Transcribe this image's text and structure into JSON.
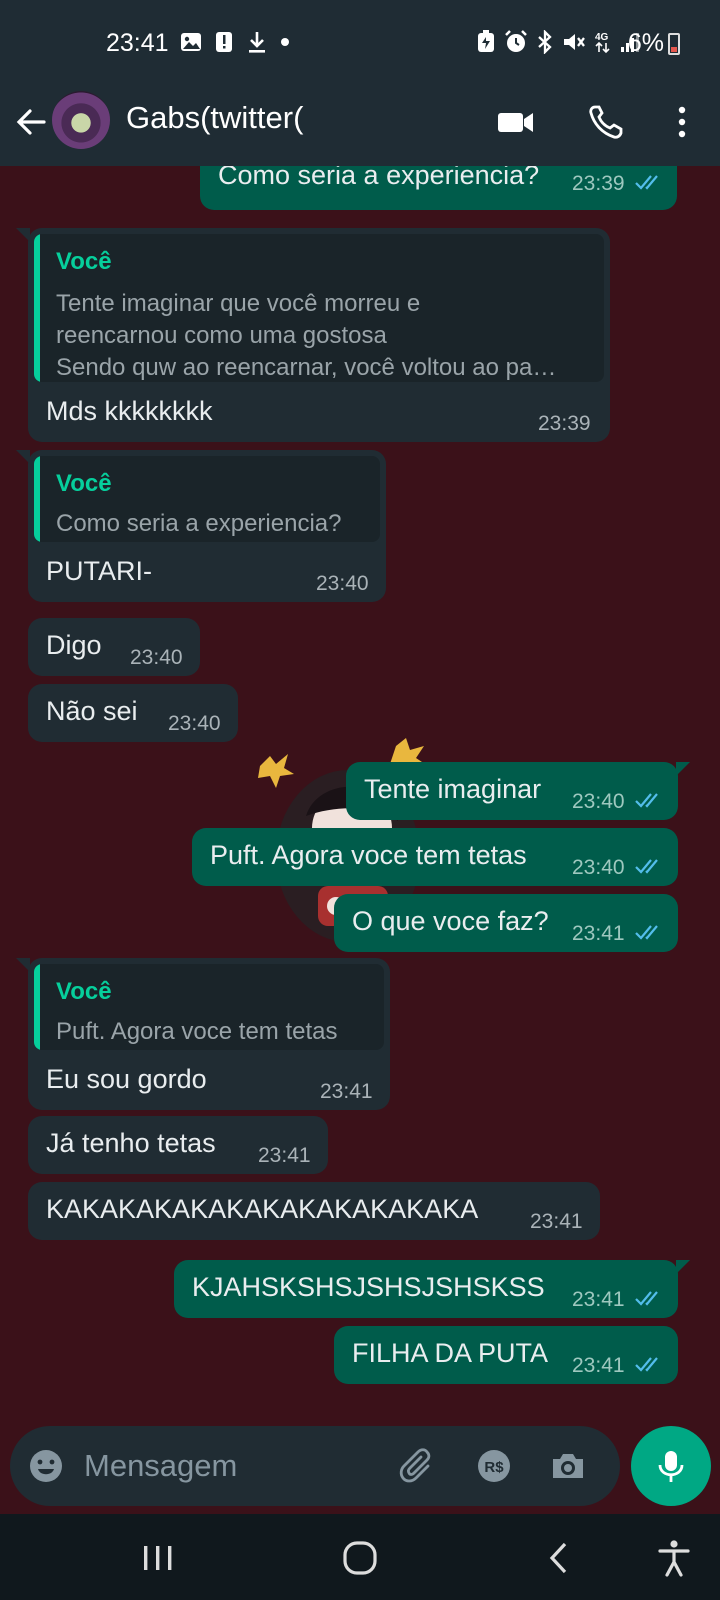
{
  "status_bar": {
    "time": "23:41",
    "battery": "6%",
    "icons": [
      "image-icon",
      "alert-icon",
      "download-icon",
      "dot-icon",
      "battery-saver-icon",
      "alarm-icon",
      "bluetooth-icon",
      "mute-icon",
      "4g-icon",
      "signal-icon"
    ]
  },
  "header": {
    "contact_name": "Gabs(twitter(",
    "icons": [
      "back-arrow-icon",
      "video-call-icon",
      "voice-call-icon",
      "more-options-icon"
    ]
  },
  "messages": [
    {
      "dir": "out",
      "text": "Como seria a experiencia?",
      "time": "23:39",
      "read": true
    },
    {
      "dir": "in",
      "quote_author": "Você",
      "quote_lines": [
        "Tente imaginar que você morreu e",
        "reencarnou como uma gostosa",
        "Sendo quw ao reencarnar, você voltou ao pa…"
      ],
      "text": "Mds kkkkkkkk",
      "time": "23:39"
    },
    {
      "dir": "in",
      "quote_author": "Você",
      "quote_lines": [
        "Como seria a experiencia?"
      ],
      "text": "PUTARI-",
      "time": "23:40"
    },
    {
      "dir": "in",
      "text": "Digo",
      "time": "23:40"
    },
    {
      "dir": "in",
      "text": "Não sei",
      "time": "23:40"
    },
    {
      "dir": "out",
      "text": "Tente imaginar",
      "time": "23:40",
      "read": true
    },
    {
      "dir": "out",
      "text": "Puft. Agora voce tem tetas",
      "time": "23:40",
      "read": true
    },
    {
      "dir": "out",
      "text": "O que voce faz?",
      "time": "23:41",
      "read": true
    },
    {
      "dir": "in",
      "quote_author": "Você",
      "quote_lines": [
        "Puft. Agora voce tem tetas"
      ],
      "text": "Eu sou gordo",
      "time": "23:41"
    },
    {
      "dir": "in",
      "text": "Já tenho tetas",
      "time": "23:41"
    },
    {
      "dir": "in",
      "text": "KAKAKAKAKAKAKAKAKAKAKAKA",
      "time": "23:41"
    },
    {
      "dir": "out",
      "text": "KJAHSKSHSJSHSJSHSKSS",
      "time": "23:41",
      "read": true
    },
    {
      "dir": "out",
      "text": "FILHA DA PUTA",
      "time": "23:41",
      "read": true
    }
  ],
  "input": {
    "placeholder": "Mensagem",
    "icons": [
      "emoji-icon",
      "attach-icon",
      "payment-icon",
      "camera-icon",
      "mic-icon"
    ]
  },
  "colors": {
    "chat_background": "#3b1119",
    "incoming_bubble": "#202c33",
    "outgoing_bubble": "#005c4b",
    "accent": "#00a884",
    "quote_author": "#06cf9c",
    "read_tick": "#53bdeb"
  }
}
